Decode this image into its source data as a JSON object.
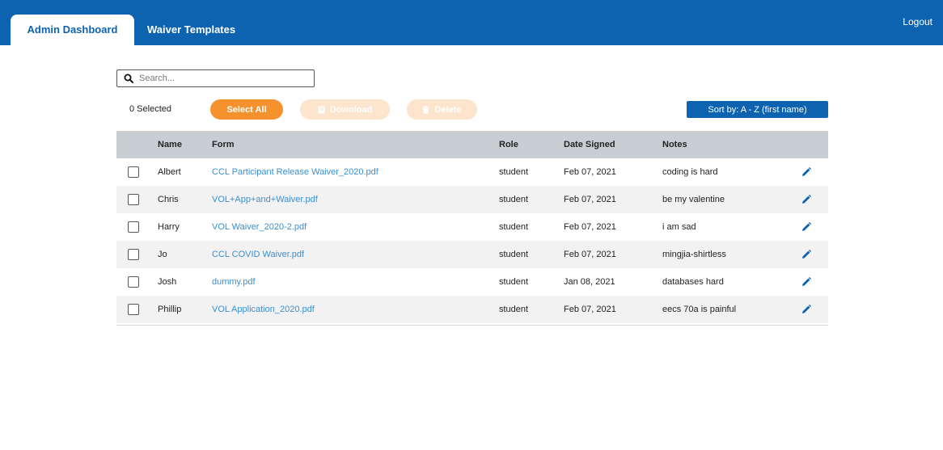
{
  "tabs": [
    {
      "label": "Admin Dashboard"
    },
    {
      "label": "Waiver Templates"
    }
  ],
  "header": {
    "logout_label": "Logout"
  },
  "search": {
    "placeholder": "Search...",
    "icon": "search-icon"
  },
  "toolbar": {
    "selected_label": "0 Selected",
    "select_all_label": "Select All",
    "download_label": "Download",
    "delete_label": "Delete",
    "sort_label": "Sort by: A - Z (first name)"
  },
  "table": {
    "headers": [
      "Name",
      "Form",
      "Role",
      "Date Signed",
      "Notes"
    ],
    "rows": [
      {
        "name": "Albert",
        "form": "CCL Participant Release Waiver_2020.pdf",
        "role": "student",
        "date": "Feb 07, 2021",
        "notes": "coding is hard"
      },
      {
        "name": "Chris",
        "form": "VOL+App+and+Waiver.pdf",
        "role": "student",
        "date": "Feb 07, 2021",
        "notes": "be my valentine"
      },
      {
        "name": "Harry",
        "form": "VOL Waiver_2020-2.pdf",
        "role": "student",
        "date": "Feb 07, 2021",
        "notes": "i am sad"
      },
      {
        "name": "Jo",
        "form": "CCL COVID Waiver.pdf",
        "role": "student",
        "date": "Feb 07, 2021",
        "notes": "mingjia-shirtless"
      },
      {
        "name": "Josh",
        "form": "dummy.pdf",
        "role": "student",
        "date": "Jan 08, 2021",
        "notes": "databases hard"
      },
      {
        "name": "Phillip",
        "form": "VOL Application_2020.pdf",
        "role": "student",
        "date": "Feb 07, 2021",
        "notes": "eecs 70a is painful"
      }
    ]
  },
  "colors": {
    "brand": "#0e63b0",
    "accent": "#f5922e",
    "link": "#3a8fd0"
  }
}
